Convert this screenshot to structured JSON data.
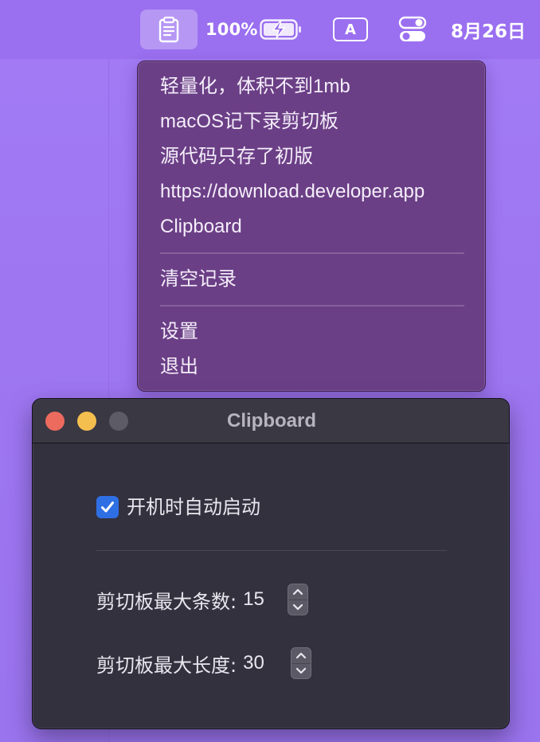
{
  "menubar": {
    "clipboard_icon": "clipboard-icon",
    "battery_percent": "100%",
    "battery_icon": "battery-charging-icon",
    "input_source": "A",
    "control_center_icon": "control-center-icon",
    "date": "8月26日"
  },
  "menu": {
    "history": [
      "轻量化，体积不到1mb",
      "macOS记下录剪切板",
      "源代码只存了初版",
      "https://download.developer.app",
      "Clipboard"
    ],
    "clear_label": "清空记录",
    "settings_label": "设置",
    "quit_label": "退出"
  },
  "window": {
    "title": "Clipboard",
    "launch_at_login": {
      "label": "开机时自动启动",
      "checked": true
    },
    "max_items": {
      "label": "剪切板最大条数:",
      "value": "15"
    },
    "max_length": {
      "label": "剪切板最大长度:",
      "value": "30"
    }
  },
  "colors": {
    "desktop": "#a27bf5",
    "menubar": "#9a6ff0",
    "menu_background": "#6b3f86",
    "window_background": "#34313f",
    "checkbox_accent": "#2f6fe4",
    "close": "#ed6a5e",
    "minimize": "#f5bf4f"
  }
}
